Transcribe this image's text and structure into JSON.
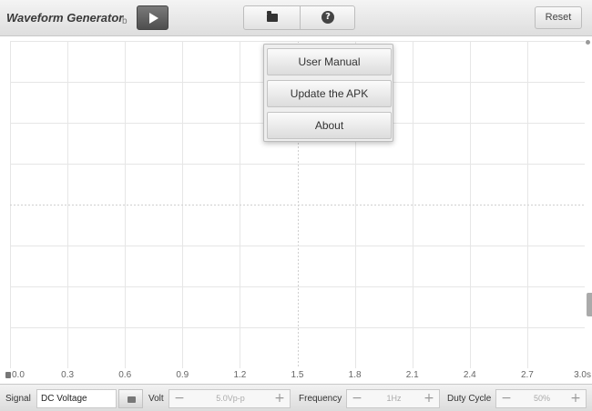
{
  "header": {
    "title": "Waveform Generator",
    "title_suffix": "b",
    "reset_label": "Reset"
  },
  "icons": {
    "play": "play-icon",
    "folder": "folder-icon",
    "help": "help-icon",
    "help_glyph": "?"
  },
  "menu": {
    "items": [
      "User Manual",
      "Update the APK",
      "About"
    ]
  },
  "axis": {
    "x_ticks": [
      "0.0",
      "0.3",
      "0.6",
      "0.9",
      "1.2",
      "1.5",
      "1.8",
      "2.1",
      "2.4",
      "2.7",
      "3.0s"
    ]
  },
  "controls": {
    "signal_label": "Signal",
    "signal_value": "DC Voltage",
    "volt_label": "Volt",
    "volt_value": "5.0Vp-p",
    "frequency_label": "Frequency",
    "frequency_value": "1Hz",
    "duty_label": "Duty Cycle",
    "duty_value": "50%",
    "minus": "−",
    "plus": "+"
  },
  "colors": {
    "grid_line": "#e6e6e6",
    "center_line": "#cfcfcf",
    "toolbar": "#e4e4e4"
  }
}
